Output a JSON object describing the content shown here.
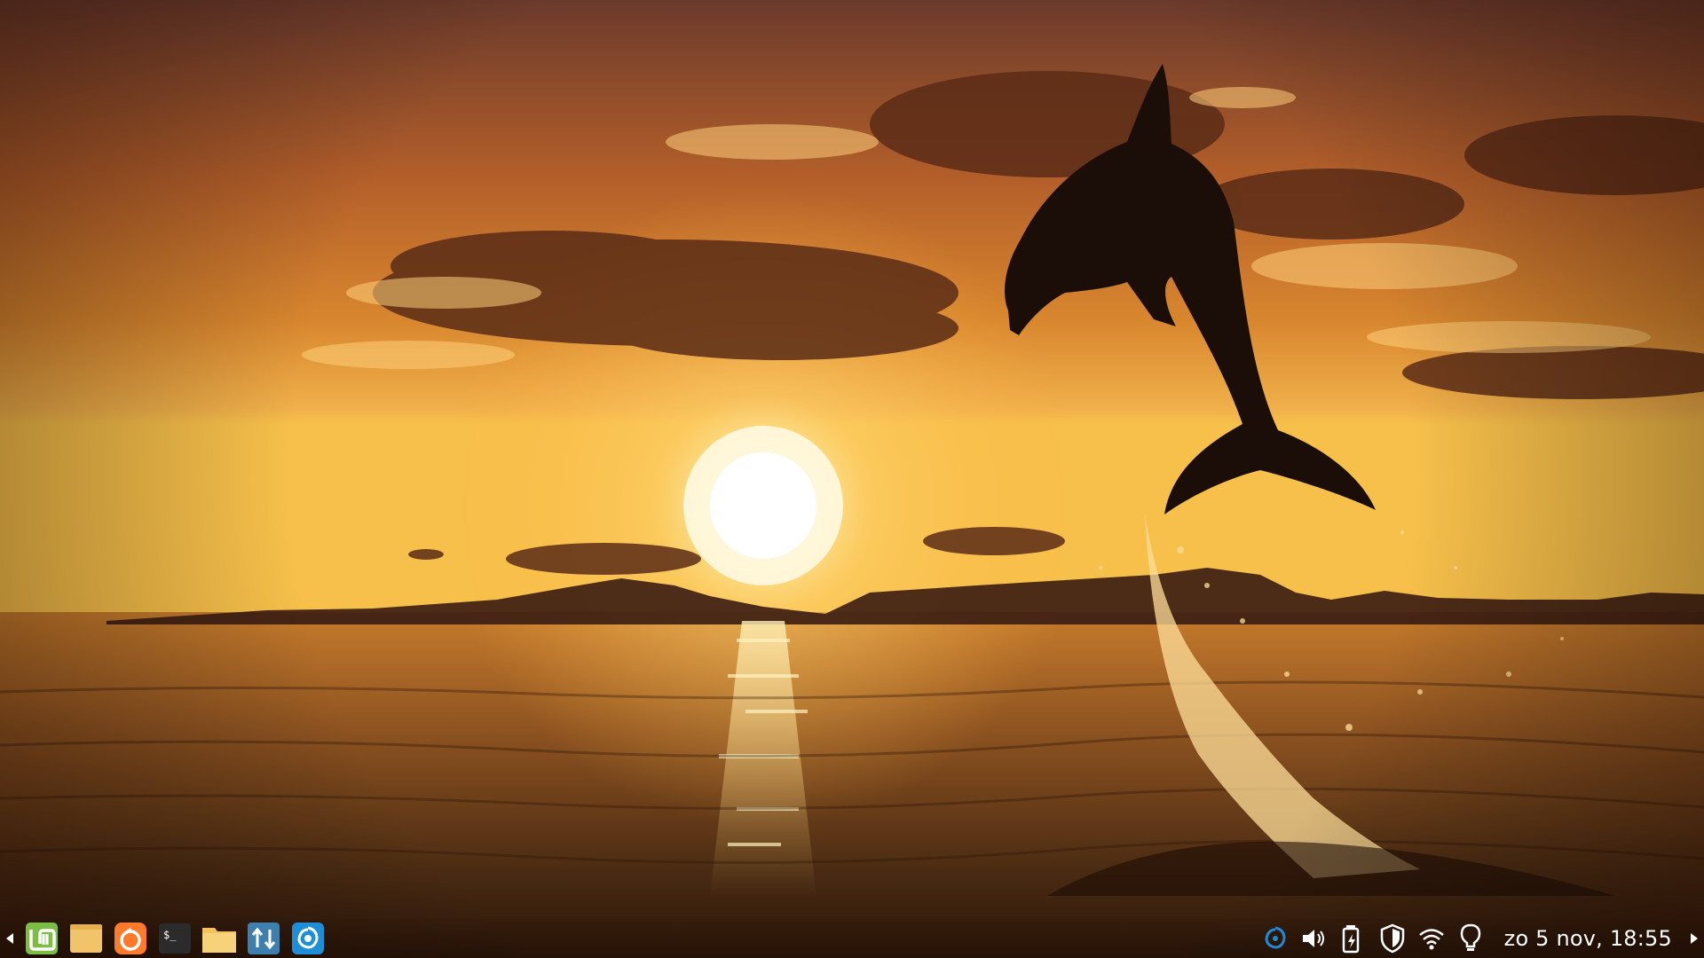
{
  "desktop": {
    "wallpaper": "dolphin-sunset",
    "colors": {
      "sky_top": "#6b3a2b",
      "sky_mid": "#d8862e",
      "horizon": "#f7c04a",
      "sun": "#fff6d0",
      "sea": "#4a2b12",
      "silhouette": "#1b0e08"
    }
  },
  "taskbar": {
    "left_scroll_icon": "triangle-left",
    "right_scroll_icon": "triangle-right",
    "launchers": [
      {
        "name": "menu-button",
        "icon": "mint-logo",
        "color": "#7dbd44"
      },
      {
        "name": "show-desktop-button",
        "icon": "folder-yellow",
        "color": "#f1c46a"
      },
      {
        "name": "firefox-launcher",
        "icon": "firefox-icon",
        "color": "#ff7a2a"
      },
      {
        "name": "terminal-launcher",
        "icon": "terminal-icon",
        "color": "#2b2b2b"
      },
      {
        "name": "files-launcher",
        "icon": "files-folder-icon",
        "color": "#f3c25b"
      },
      {
        "name": "update-manager-launcher",
        "icon": "update-arrows-icon",
        "color": "#3f7fae"
      },
      {
        "name": "app-launcher",
        "icon": "swirl-icon",
        "color": "#1e8fd6"
      }
    ],
    "tray": [
      {
        "name": "swirl-tray-icon",
        "icon": "swirl"
      },
      {
        "name": "volume-icon",
        "icon": "speaker"
      },
      {
        "name": "battery-icon",
        "icon": "battery-charging"
      },
      {
        "name": "shield-icon",
        "icon": "shield"
      },
      {
        "name": "wifi-icon",
        "icon": "wifi"
      },
      {
        "name": "bulb-icon",
        "icon": "light-bulb"
      }
    ],
    "clock": "zo  5 nov, 18:55"
  }
}
